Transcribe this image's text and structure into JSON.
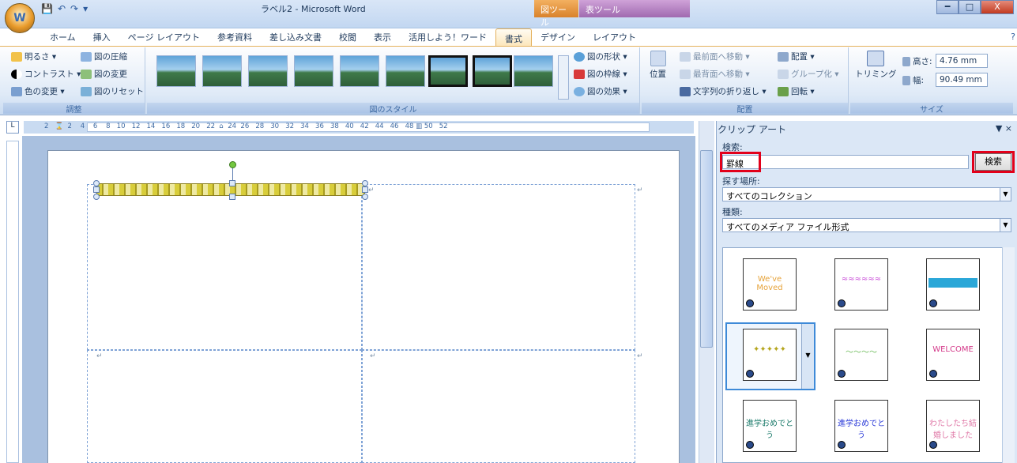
{
  "window": {
    "title": "ラベル2 - Microsoft Word",
    "ctx_tab_picture": "図ツール",
    "ctx_tab_table": "表ツール",
    "office_button": "W",
    "minimize": "━",
    "maximize": "□",
    "close": "X"
  },
  "tabs": [
    {
      "label": "ホーム"
    },
    {
      "label": "挿入"
    },
    {
      "label": "ページ レイアウト"
    },
    {
      "label": "参考資料"
    },
    {
      "label": "差し込み文書"
    },
    {
      "label": "校閲"
    },
    {
      "label": "表示"
    },
    {
      "label": "活用しよう！ワード"
    },
    {
      "label": "書式"
    },
    {
      "label": "デザイン"
    },
    {
      "label": "レイアウト"
    }
  ],
  "active_tab": "書式",
  "ribbon": {
    "adjust": {
      "label": "調整",
      "brightness": "明るさ ▾",
      "contrast": "コントラスト ▾",
      "recolor": "色の変更 ▾",
      "compress": "図の圧縮",
      "change_picture": "図の変更",
      "reset_picture": "図のリセット"
    },
    "styles": {
      "label": "図のスタイル",
      "shape": "図の形状 ▾",
      "border": "図の枠線 ▾",
      "effects": "図の効果 ▾"
    },
    "arrange": {
      "label": "配置",
      "position": "位置",
      "bring_front": "最前面へ移動 ▾",
      "send_back": "最背面へ移動 ▾",
      "text_wrap": "文字列の折り返し ▾",
      "align": "配置 ▾",
      "group": "グループ化 ▾",
      "rotate": "回転 ▾"
    },
    "size": {
      "label": "サイズ",
      "crop": "トリミング",
      "height_label": "高さ:",
      "height_value": "4.76 mm",
      "width_label": "幅:",
      "width_value": "90.49 mm"
    }
  },
  "ruler": {
    "corner": "L",
    "numbers": "2   ⌛  2    4    6    8   10   12   14   16   18   20   22  ⌂  24  26   28   30   32   34   36   38   40   42   44   46   48 ▥ 50   52"
  },
  "doc": {
    "para_mark": "↵"
  },
  "pane": {
    "title": "クリップ アート",
    "controls": "▼ ×",
    "search_label": "検索:",
    "search_value": "罫線",
    "search_button": "検索",
    "location_label": "探す場所:",
    "location_value": "すべてのコレクション",
    "type_label": "種類:",
    "type_value": "すべてのメディア ファイル形式",
    "clips": [
      {
        "text": "We've Moved",
        "color": "#e6a33a"
      },
      {
        "text": "≈≈≈≈≈≈",
        "color": "#c94fd8"
      },
      {
        "text": "",
        "color": "#2aa7d8"
      },
      {
        "text": "✦✦✦✦✦",
        "color": "#b5a51c"
      },
      {
        "text": "～～～～",
        "color": "#6dbb5a"
      },
      {
        "text": "WELCOME",
        "color": "#d43a8a"
      },
      {
        "text": "進学おめでとう",
        "color": "#1a7a6a"
      },
      {
        "text": "進学おめでとう",
        "color": "#2a3ad8"
      },
      {
        "text": "わたしたち結婚しました",
        "color": "#e07aa8"
      }
    ]
  }
}
